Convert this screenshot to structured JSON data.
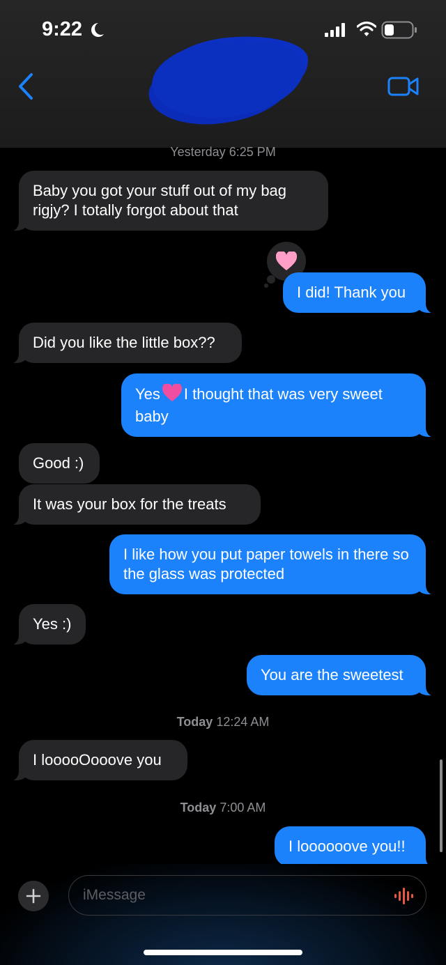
{
  "status_bar": {
    "time": "9:22"
  },
  "header": {
    "back_icon": "chevron-left-icon",
    "video_icon": "video-camera-icon",
    "accent": "#1c82fb"
  },
  "timestamps": [
    {
      "day": "Yesterday",
      "time": "6:25 PM"
    },
    {
      "day": "Today",
      "time": "12:24 AM"
    },
    {
      "day": "Today",
      "time": "7:00 AM"
    }
  ],
  "messages": [
    {
      "from": "them",
      "text": "Baby you got your stuff out of my bag rigjy? I totally forgot about that"
    },
    {
      "from": "me",
      "text": "I did! Thank you",
      "tapback": "pink-heart"
    },
    {
      "from": "them",
      "text": "Did you like the little box??"
    },
    {
      "from": "me",
      "text_before": "Yes",
      "text_after": "I thought that was very sweet baby",
      "emoji": "pink-heart"
    },
    {
      "from": "them",
      "text": "Good :)"
    },
    {
      "from": "them",
      "text": "It was your box for the treats"
    },
    {
      "from": "me",
      "text": "I like how you put paper towels in there so the glass was protected"
    },
    {
      "from": "them",
      "text": "Yes :)"
    },
    {
      "from": "me",
      "text": "You are the sweetest"
    },
    {
      "from": "them",
      "text": "I looooOooove you"
    },
    {
      "from": "me",
      "text": "I loooooove you!!"
    }
  ],
  "composer": {
    "placeholder": "iMessage",
    "plus_icon": "plus-icon",
    "audio_icon": "waveform-icon"
  },
  "colors": {
    "sent_bubble": "#1c82fb",
    "received_bubble": "#262628",
    "background": "#000000"
  }
}
